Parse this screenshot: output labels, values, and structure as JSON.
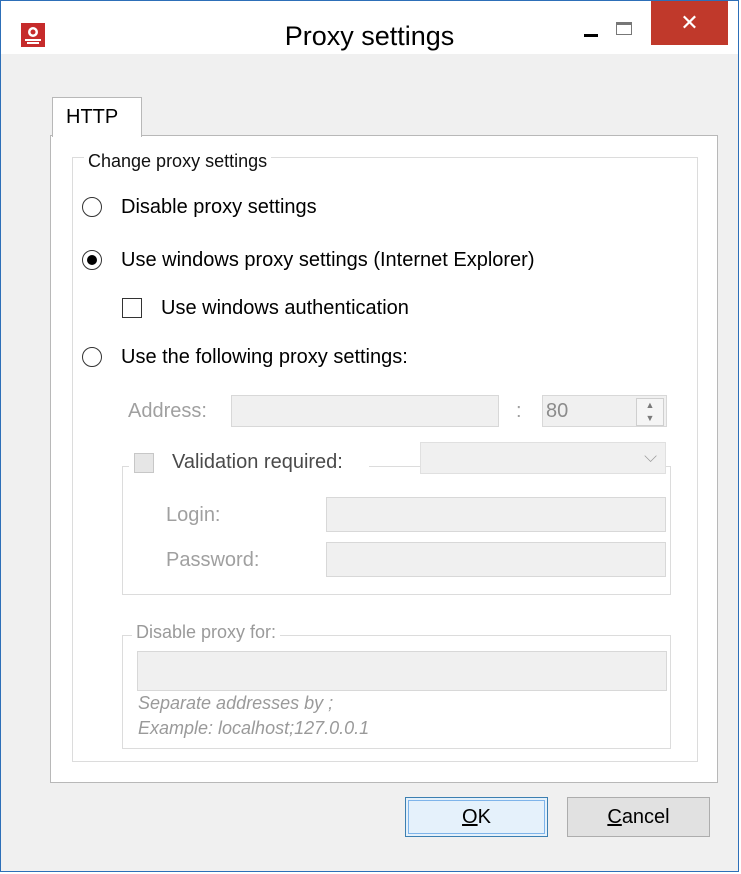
{
  "window": {
    "title": "Proxy settings",
    "minimize_glyph": "–",
    "close_glyph": "✕"
  },
  "tabs": [
    {
      "label": "HTTP",
      "active": true
    }
  ],
  "proxy_group": {
    "legend": "Change proxy settings",
    "options": {
      "disable": {
        "label": "Disable proxy settings",
        "checked": false
      },
      "windows": {
        "label": "Use windows proxy settings (Internet Explorer)",
        "checked": true
      },
      "windows_auth": {
        "label": "Use windows authentication",
        "checked": false
      },
      "manual": {
        "label": "Use the following proxy settings:",
        "checked": false
      }
    },
    "address": {
      "label": "Address:",
      "value": "",
      "separator": ":",
      "port": "80"
    },
    "validation": {
      "label": "Validation required:",
      "checked": false,
      "dropdown_value": "",
      "login_label": "Login:",
      "login_value": "",
      "password_label": "Password:",
      "password_value": ""
    },
    "bypass": {
      "legend": "Disable proxy for:",
      "value": "",
      "hint_line1": "Separate addresses by ;",
      "hint_line2": "Example: localhost;127.0.0.1"
    }
  },
  "buttons": {
    "ok": {
      "mnemonic": "O",
      "rest": "K"
    },
    "cancel": {
      "mnemonic": "C",
      "rest": "ancel"
    }
  },
  "colors": {
    "close_button": "#c0392b",
    "disabled_text": "#a0a0a0",
    "default_button_border": "#3c7fb1"
  }
}
